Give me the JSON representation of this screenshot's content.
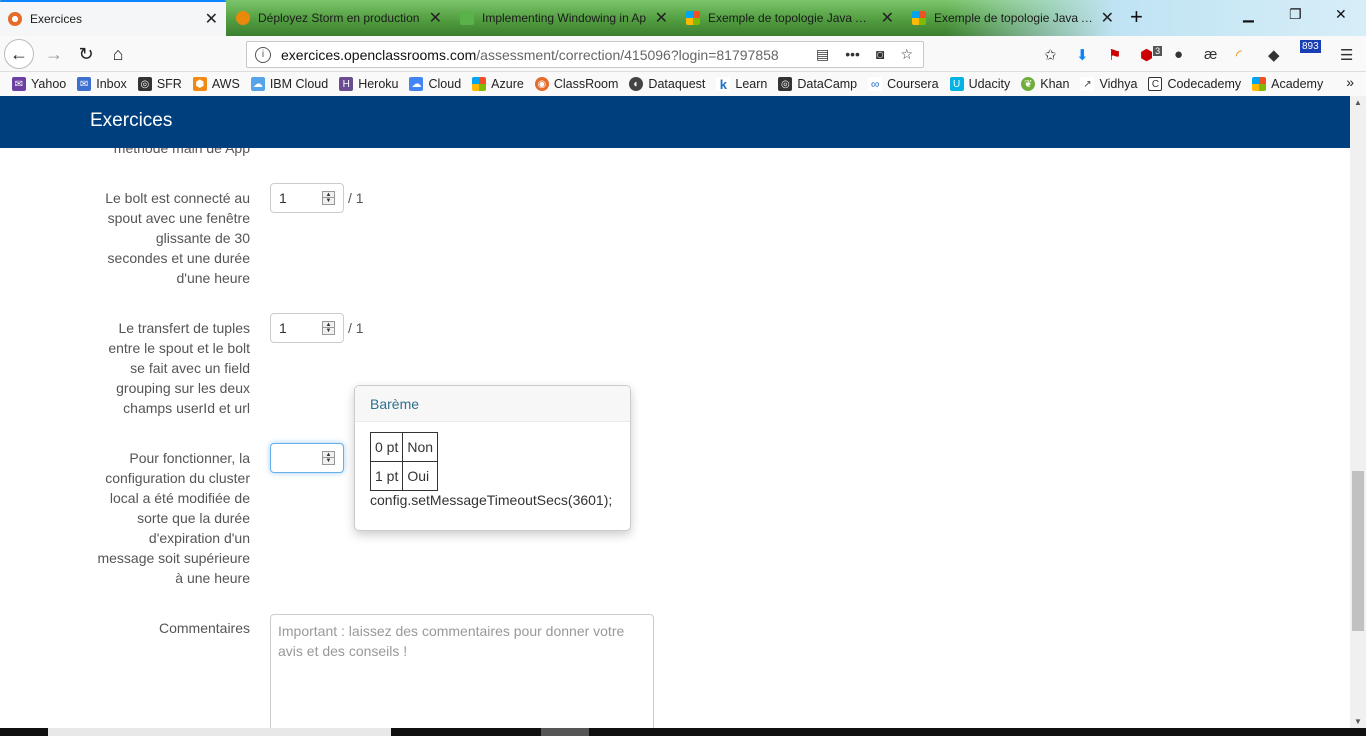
{
  "browser": {
    "tabs": [
      {
        "title": "Exercices",
        "favicon": "openclassrooms-icon",
        "active": true
      },
      {
        "title": "Déployez Storm en production",
        "favicon": "storm-icon",
        "active": false
      },
      {
        "title": "Implementing Windowing in Ap",
        "favicon": "android-icon",
        "active": false
      },
      {
        "title": "Exemple de topologie Java Apa",
        "favicon": "windows-icon",
        "active": false
      },
      {
        "title": "Exemple de topologie Java Apa",
        "favicon": "windows-icon",
        "active": false
      }
    ],
    "url_domain": "exercices.openclassrooms.com",
    "url_path": "/assessment/correction/415096?login=81797858",
    "toolbar_badges": {
      "adblock_count": "3",
      "counter": "893"
    },
    "bookmarks": [
      {
        "label": "Yahoo",
        "icon": "mail-icon",
        "color": "#6c3fa0"
      },
      {
        "label": "Inbox",
        "icon": "inbox-icon",
        "color": "#3d6fd1"
      },
      {
        "label": "SFR",
        "icon": "globe-icon",
        "color": "#333333"
      },
      {
        "label": "AWS",
        "icon": "aws-icon",
        "color": "#f08a17"
      },
      {
        "label": "IBM Cloud",
        "icon": "cloud-icon",
        "color": "#56a5e8"
      },
      {
        "label": "Heroku",
        "icon": "heroku-icon",
        "color": "#6a4c93"
      },
      {
        "label": "Cloud",
        "icon": "gcloud-icon",
        "color": "#4285f4"
      },
      {
        "label": "Azure",
        "icon": "windows-icon",
        "color": "#00a4ef"
      },
      {
        "label": "ClassRoom",
        "icon": "openclassrooms-icon",
        "color": "#e56b2b"
      },
      {
        "label": "Dataquest",
        "icon": "dataquest-icon",
        "color": "#444444"
      },
      {
        "label": "Learn",
        "icon": "k-icon",
        "color": "#1a73c8"
      },
      {
        "label": "DataCamp",
        "icon": "globe-icon",
        "color": "#333333"
      },
      {
        "label": "Coursera",
        "icon": "coursera-icon",
        "color": "#2a73cc"
      },
      {
        "label": "Udacity",
        "icon": "udacity-icon",
        "color": "#02b3e4"
      },
      {
        "label": "Khan",
        "icon": "leaf-icon",
        "color": "#6fae3b"
      },
      {
        "label": "Vidhya",
        "icon": "chart-icon",
        "color": "#444444"
      },
      {
        "label": "Codecademy",
        "icon": "codecademy-icon",
        "color": "#333333"
      },
      {
        "label": "Academy",
        "icon": "windows-icon",
        "color": "#f25022"
      }
    ]
  },
  "site": {
    "brand": "Exercices",
    "cut_label": "méthode main de App"
  },
  "criteria": [
    {
      "label_lines": [
        "Le bolt est connecté au",
        "spout avec une fenêtre",
        "glissante de 30",
        "secondes et une durée",
        "d'une heure"
      ],
      "value": "1",
      "max": "/ 1"
    },
    {
      "label_lines": [
        "Le transfert de tuples",
        "entre le spout et le bolt",
        "se fait avec un field",
        "grouping sur les deux",
        "champs userId et url"
      ],
      "value": "1",
      "max": "/ 1"
    },
    {
      "label_lines": [
        "Pour fonctionner, la",
        "configuration du cluster",
        "local a été modifiée de",
        "sorte que la durée",
        "d'expiration d'un",
        "message soit supérieure",
        "à une heure"
      ],
      "value": "",
      "max": ""
    }
  ],
  "bareme": {
    "title": "Barème",
    "rows": [
      {
        "points": "0 pt",
        "answer": "Non"
      },
      {
        "points": "1 pt",
        "answer": "Oui"
      }
    ],
    "code": "config.setMessageTimeoutSecs(3601);"
  },
  "comments": {
    "label": "Commentaires",
    "placeholder": "Important : laissez des commentaires pour donner votre avis et des conseils !"
  },
  "colors": {
    "header_bg": "#003f7e",
    "popover_title": "#31708f",
    "focus": "#66afe9"
  }
}
